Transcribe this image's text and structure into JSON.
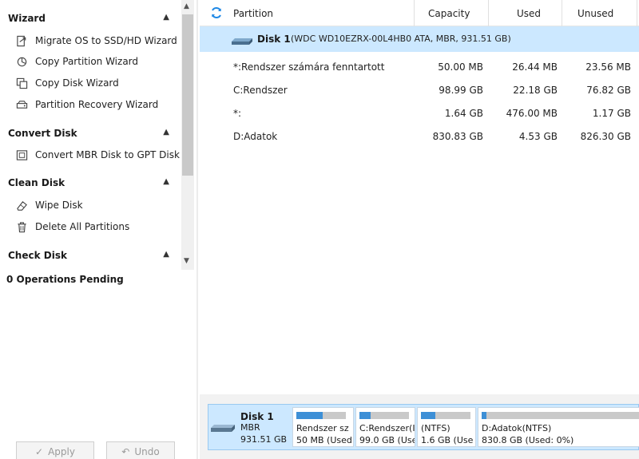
{
  "sidebar": {
    "sections": [
      {
        "title": "Wizard",
        "items": [
          {
            "label": "Migrate OS to SSD/HD Wizard",
            "icon": "migrate-icon"
          },
          {
            "label": "Copy Partition Wizard",
            "icon": "copy-partition-icon"
          },
          {
            "label": "Copy Disk Wizard",
            "icon": "copy-disk-icon"
          },
          {
            "label": "Partition Recovery Wizard",
            "icon": "recovery-icon"
          }
        ]
      },
      {
        "title": "Convert Disk",
        "items": [
          {
            "label": "Convert MBR Disk to GPT Disk",
            "icon": "convert-icon"
          }
        ]
      },
      {
        "title": "Clean Disk",
        "items": [
          {
            "label": "Wipe Disk",
            "icon": "eraser-icon"
          },
          {
            "label": "Delete All Partitions",
            "icon": "trash-icon"
          }
        ]
      },
      {
        "title": "Check Disk",
        "items": []
      }
    ],
    "operations_pending": "0 Operations Pending",
    "apply_label": "Apply",
    "undo_label": "Undo"
  },
  "table": {
    "columns": [
      "Partition",
      "Capacity",
      "Used",
      "Unused"
    ],
    "disk": {
      "name": "Disk 1",
      "description": "(WDC WD10EZRX-00L4HB0 ATA, MBR, 931.51 GB)"
    },
    "rows": [
      {
        "partition": "*:Rendszer számára fenntartott",
        "capacity": "50.00 MB",
        "used": "26.44 MB",
        "unused": "23.56 MB"
      },
      {
        "partition": "C:Rendszer",
        "capacity": "98.99 GB",
        "used": "22.18 GB",
        "unused": "76.82 GB"
      },
      {
        "partition": "*:",
        "capacity": "1.64 GB",
        "used": "476.00 MB",
        "unused": "1.17 GB"
      },
      {
        "partition": "D:Adatok",
        "capacity": "830.83 GB",
        "used": "4.53 GB",
        "unused": "826.30 GB"
      }
    ]
  },
  "disk_map": {
    "disk_label": "Disk 1",
    "scheme": "MBR",
    "size": "931.51 GB",
    "partitions": [
      {
        "line1": "Rendszer sz",
        "line2": "50 MB (Used",
        "used_fraction": 0.53
      },
      {
        "line1": "C:Rendszer(I",
        "line2": "99.0 GB (Use",
        "used_fraction": 0.22
      },
      {
        "line1": "(NTFS)",
        "line2": "1.6 GB (Use",
        "used_fraction": 0.29
      },
      {
        "line1": "D:Adatok(NTFS)",
        "line2": "830.8 GB (Used: 0%)",
        "used_fraction": 0.01
      }
    ]
  },
  "colors": {
    "accent": "#3d8fd6",
    "selection": "#cce8ff",
    "refresh": "#1e88e5"
  }
}
